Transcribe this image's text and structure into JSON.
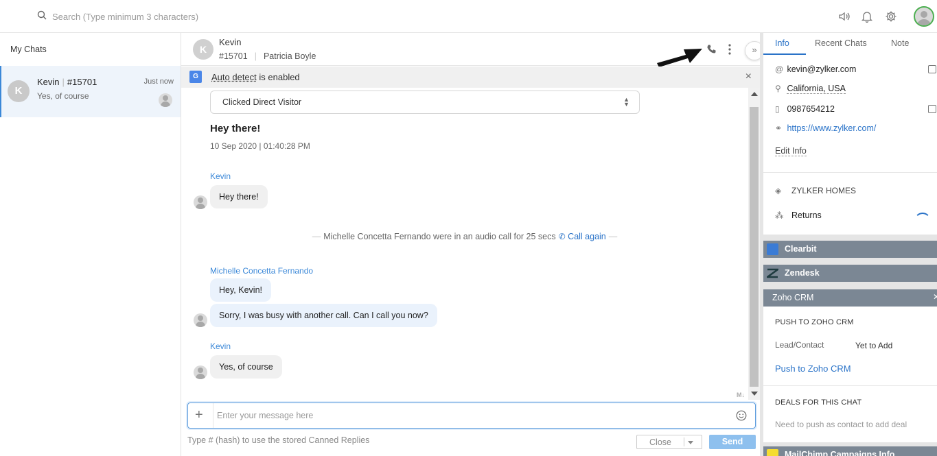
{
  "topbar": {
    "search_placeholder": "Search (Type minimum 3 characters)",
    "icons": [
      "search-icon",
      "speaker-icon",
      "bell-icon",
      "gear-icon",
      "user-avatar"
    ]
  },
  "sidebar": {
    "title": "My Chats",
    "chats": [
      {
        "initial": "K",
        "name": "Kevin",
        "id": "#15701",
        "time": "Just now",
        "preview": "Yes, of course"
      }
    ]
  },
  "chat_header": {
    "initial": "K",
    "visitor_name": "Kevin",
    "visitor_id": "#15701",
    "agent_name": "Patricia Boyle",
    "collapse_label": "»"
  },
  "autodetect": {
    "link_text": "Auto detect",
    "rest_text": " is enabled",
    "close": "×"
  },
  "conversation": {
    "visitor_select": "Clicked Direct Visitor",
    "greeting": "Hey there!",
    "greeting_time": "10 Sep 2020 | 01:40:28 PM",
    "messages": [
      {
        "sender": "Kevin",
        "text": "Hey there!"
      },
      {
        "sender": "Michelle Concetta Fernando",
        "text": "Hey, Kevin!"
      },
      {
        "sender": "Michelle Concetta Fernando",
        "text": "Sorry, I was busy with another call. Can I call you now?"
      },
      {
        "sender": "Kevin",
        "text": "Yes, of course"
      }
    ],
    "call_notice": "Michelle Concetta Fernando were in an audio call for 25 secs",
    "call_again": "Call again",
    "markdown_badge": "M↓"
  },
  "composer": {
    "placeholder": "Enter your message here",
    "plus": "+",
    "hint": "Type # (hash) to use the stored Canned Replies",
    "close_label": "Close",
    "send_label": "Send"
  },
  "info_panel": {
    "tabs": [
      "Info",
      "Recent Chats",
      "Note"
    ],
    "email": "kevin@zylker.com",
    "location": "California, USA",
    "phone": "0987654212",
    "website": "https://www.zylker.com/",
    "edit_label": "Edit Info",
    "department": "ZYLKER HOMES",
    "topic": "Returns"
  },
  "integrations": {
    "clearbit": "Clearbit",
    "zendesk": "Zendesk",
    "zoho": {
      "title": "Zoho CRM",
      "push_section": "PUSH TO ZOHO CRM",
      "lead_label": "Lead/Contact",
      "lead_value": "Yet to Add",
      "push_link": "Push to Zoho CRM",
      "deals_section": "DEALS FOR THIS CHAT",
      "deals_note": "Need to push as contact to add deal"
    },
    "mailchimp": "MailChimp Campaigns Info",
    "toggle": "‹"
  },
  "colors": {
    "accent": "#2a73c8",
    "selected_chat_bg": "#eef4fb",
    "integration_header": "#7b8794",
    "send_button": "#8ec0ee"
  }
}
